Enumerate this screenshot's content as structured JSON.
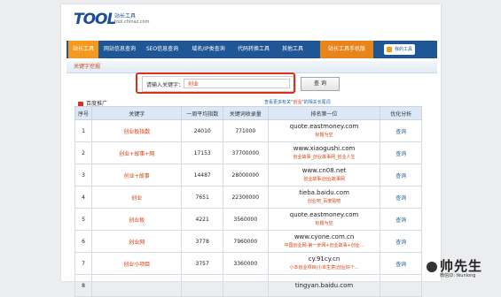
{
  "header": {
    "logo_text": "TOOL",
    "site_name": "站长工具",
    "site_url": "tool.chinaz.com"
  },
  "nav": {
    "items": [
      {
        "label": "站长工具"
      },
      {
        "label": "网站信息查询"
      },
      {
        "label": "SEO信息查询"
      },
      {
        "label": "域名/IP类查询"
      },
      {
        "label": "代码转换工具"
      },
      {
        "label": "其他工具"
      },
      {
        "label": "站长工具手机版"
      }
    ],
    "my_tools": "我的工具",
    "colors": {
      "bar": "#1f5796",
      "active": "#f39a1e"
    }
  },
  "section": {
    "title": "关键字挖掘"
  },
  "search": {
    "label": "请输入关键字：",
    "value": "创业",
    "button": "查 询",
    "highlight_color": "#d8321d"
  },
  "favorites": {
    "label": "百度推广"
  },
  "more_link": {
    "prefix": "查看更多有关\"",
    "keyword": "创业",
    "suffix": "\"的相关长尾词"
  },
  "table": {
    "headers": [
      "序号",
      "关键字",
      "一周平均指数",
      "关键词收录量",
      "排名第一位",
      "优化分析"
    ],
    "rows": [
      {
        "no": "1",
        "keyword": "创业板指数",
        "index": "24010",
        "count": "771000",
        "site": "quote.eastmoney.com",
        "title": "标题为空",
        "op": "查询"
      },
      {
        "no": "2",
        "keyword": "创业+故事+网",
        "index": "17153",
        "count": "37700000",
        "site": "www.xiaogushi.com",
        "title": "创业故事_创业故事网_创业人生",
        "op": "查询"
      },
      {
        "no": "3",
        "keyword": "创业+故事",
        "index": "14487",
        "count": "28000000",
        "site": "www.cn08.net",
        "title": "创业故事|创业故事网",
        "op": "查询"
      },
      {
        "no": "4",
        "keyword": "创业",
        "index": "7651",
        "count": "22300000",
        "site": "tieba.baidu.com",
        "title": "创业吧_百度贴吧",
        "op": "查询"
      },
      {
        "no": "5",
        "keyword": "创业板",
        "index": "4221",
        "count": "3560000",
        "site": "quote.eastmoney.com",
        "title": "标题为空",
        "op": "查询"
      },
      {
        "no": "6",
        "keyword": "创业网",
        "index": "3778",
        "count": "7960000",
        "site": "www.cyone.com.cn",
        "title": "中国创业网-第一步网+创业故事+创业...",
        "op": "查询"
      },
      {
        "no": "7",
        "keyword": "创业小项目",
        "index": "3757",
        "count": "3360000",
        "site": "cy.91cy.cn",
        "title": "小本创业项目|小本生意|创业好个...",
        "op": "查询"
      },
      {
        "no": "8",
        "keyword": "",
        "index": "",
        "count": "",
        "site": "tingyan.baidu.com",
        "title": "",
        "op": ""
      }
    ]
  },
  "watermark": {
    "text": "帅先生",
    "sub": "微信ID: tkunlong"
  }
}
